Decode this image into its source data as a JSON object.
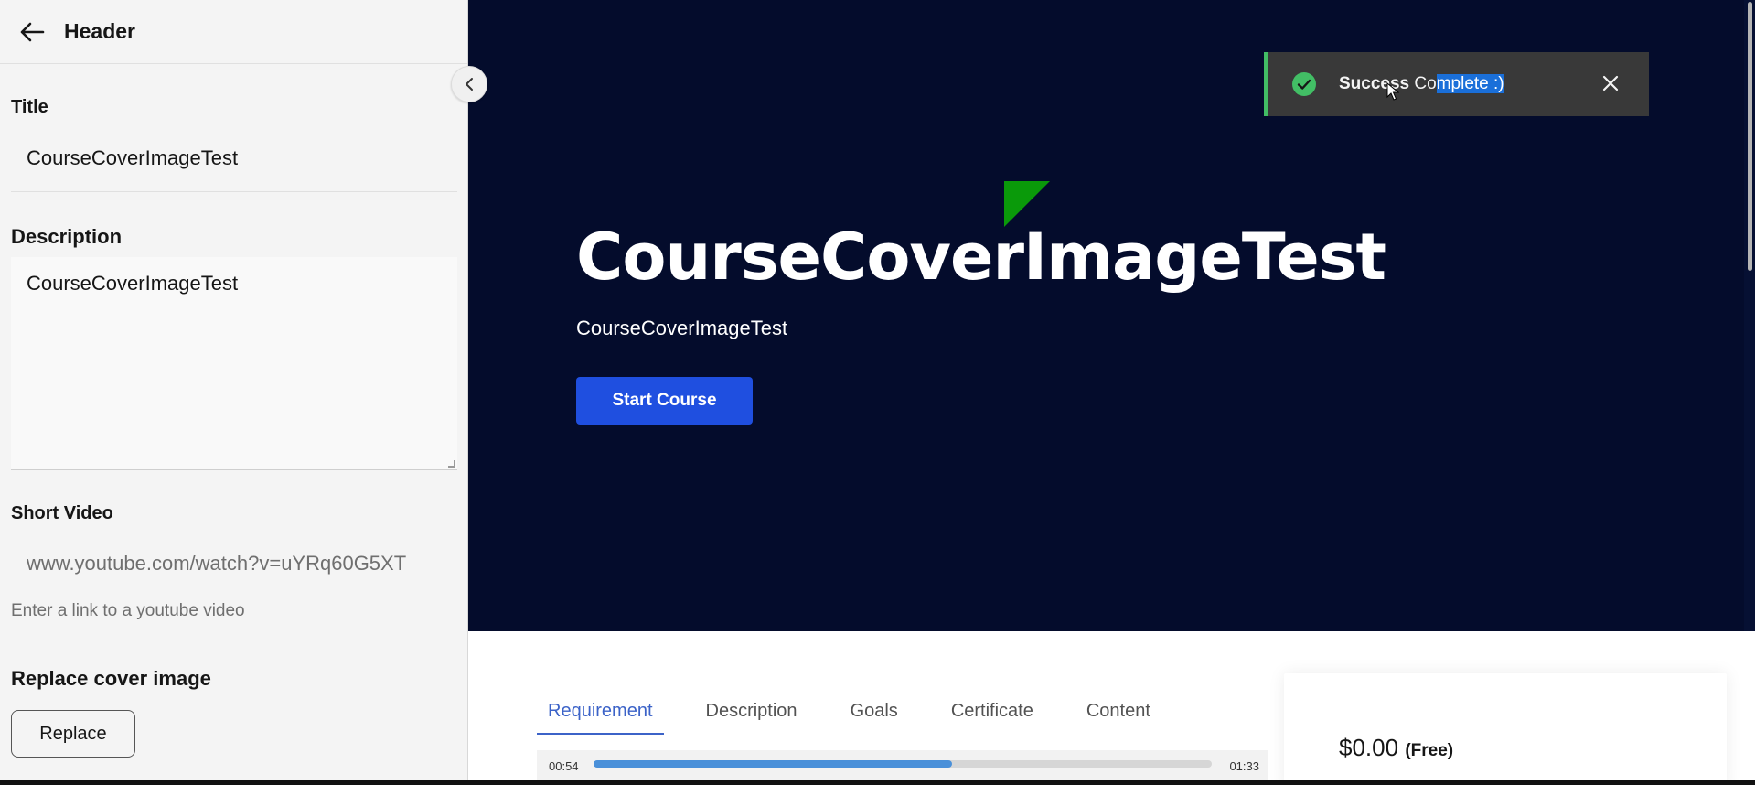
{
  "panel": {
    "header_title": "Header",
    "title_label": "Title",
    "title_value": "CourseCoverImageTest",
    "description_label": "Description",
    "description_value": "CourseCoverImageTest",
    "short_video_label": "Short Video",
    "short_video_value": "www.youtube.com/watch?v=uYRq60G5XT",
    "short_video_helper": "Enter a link to a youtube video",
    "cover_label": "Replace cover image",
    "replace_button": "Replace"
  },
  "hero": {
    "title": "CourseCoverImageTest",
    "subtitle": "CourseCoverImageTest",
    "start_button": "Start Course"
  },
  "toast": {
    "title": "Success",
    "message_prefix": " Co",
    "message_selected": "mplete :)"
  },
  "tabs": [
    {
      "label": "Requirement",
      "active": true
    },
    {
      "label": "Description",
      "active": false
    },
    {
      "label": "Goals",
      "active": false
    },
    {
      "label": "Certificate",
      "active": false
    },
    {
      "label": "Content",
      "active": false
    }
  ],
  "video_player": {
    "current_time": "00:54",
    "total_time": "01:33",
    "progress": 0.58
  },
  "price": {
    "amount": "$0.00",
    "note": "(Free)"
  },
  "colors": {
    "hero_bg": "#040c2c",
    "primary_button": "#1f4fe0",
    "success": "#42be65",
    "active_tab": "#3c63c8",
    "logo_green": "#0a9a0a"
  },
  "icons": {
    "back": "arrow-left-icon",
    "collapse": "chevron-left-icon",
    "toast_status": "checkmark-circle-icon",
    "toast_close": "close-icon"
  }
}
